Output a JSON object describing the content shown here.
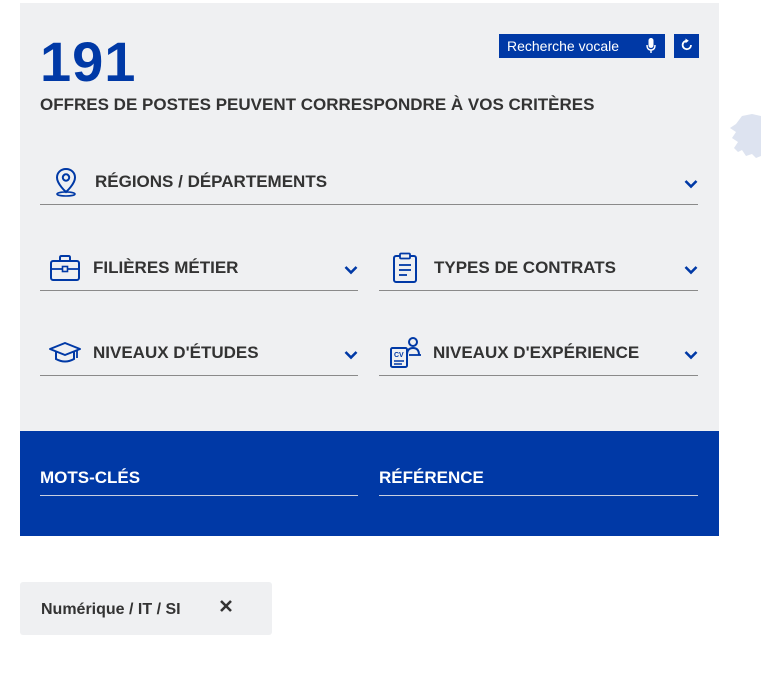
{
  "results": {
    "count": "191",
    "subtitle": "OFFRES DE POSTES PEUVENT CORRESPONDRE À VOS CRITÈRES"
  },
  "toolbar": {
    "voice_search_label": "Recherche vocale",
    "voice_icon": "microphone-icon",
    "reset_icon": "refresh-icon"
  },
  "filters": {
    "regions": {
      "label": "RÉGIONS / DÉPARTEMENTS",
      "icon": "location-pin-icon"
    },
    "filieres": {
      "label": "FILIÈRES MÉTIER",
      "icon": "briefcase-icon"
    },
    "contrats": {
      "label": "TYPES DE CONTRATS",
      "icon": "clipboard-icon"
    },
    "etudes": {
      "label": "NIVEAUX D'ÉTUDES",
      "icon": "graduation-cap-icon"
    },
    "experience": {
      "label": "NIVEAUX D'EXPÉRIENCE",
      "icon": "cv-person-icon"
    }
  },
  "search_fields": {
    "keywords": {
      "label": "MOTS-CLÉS"
    },
    "reference": {
      "label": "RÉFÉRENCE"
    }
  },
  "active_tags": [
    {
      "label": "Numérique / IT / SI"
    }
  ],
  "colors": {
    "brand_blue": "#0039a6",
    "panel_gray": "#eff0f2",
    "text_dark": "#333333"
  }
}
